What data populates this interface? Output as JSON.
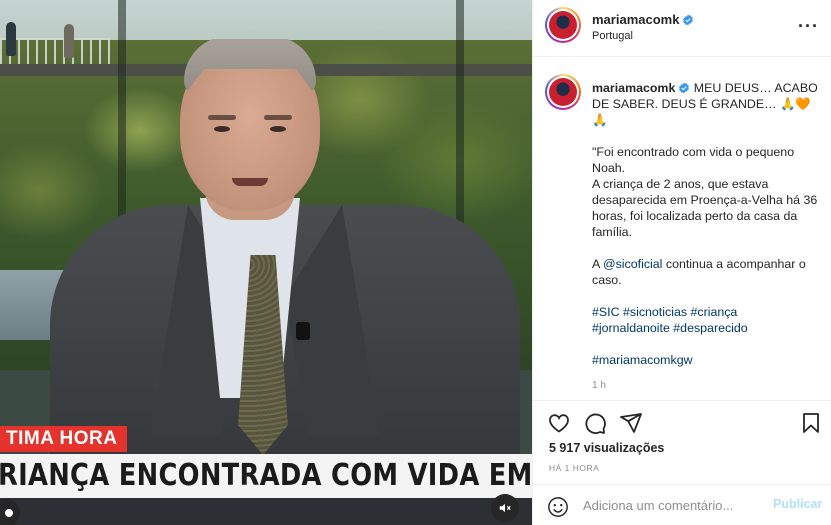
{
  "media": {
    "breaking_tag": "TIMA HORA",
    "headline": "RIANÇA ENCONTRADA COM VIDA EM PROENÇ"
  },
  "header": {
    "username": "mariamacomk",
    "location": "Portugal",
    "more_icon": "ellipsis-icon"
  },
  "caption": {
    "username": "mariamacomk",
    "intro": "MEU DEUS… ACABO DE SABER. DEUS É GRANDE…",
    "intro_emoji": "🙏🧡",
    "line_emoji": "🙏",
    "quote_lines": [
      "\"Foi encontrado com vida o pequeno Noah.",
      "A criança de 2 anos, que estava desaparecida em Proença-a-Velha há 36 horas, foi localizada perto da casa da família."
    ],
    "mention_prefix": "A ",
    "mention": "@sicoficial",
    "mention_suffix": " continua a acompanhar o caso.",
    "hashtags_1": "#SIC #sicnoticias #criança",
    "hashtags_2": "#jornaldanoite #desparecido",
    "hashtag_3": "#mariamacomkgw",
    "time": "1 h"
  },
  "actions": {
    "views": "5 917 visualizações",
    "ago": "HÁ 1 HORA",
    "icons": [
      "heart-icon",
      "comment-icon",
      "share-icon",
      "bookmark-icon"
    ]
  },
  "comment": {
    "placeholder": "Adiciona um comentário...",
    "publish_label": "Publicar",
    "emoji_icon": "smiley-icon"
  },
  "colors": {
    "link": "#00376b",
    "publish": "#b2dffc",
    "breaking_red": "#e3332c",
    "text": "#262626",
    "muted": "#8e8e8e"
  }
}
